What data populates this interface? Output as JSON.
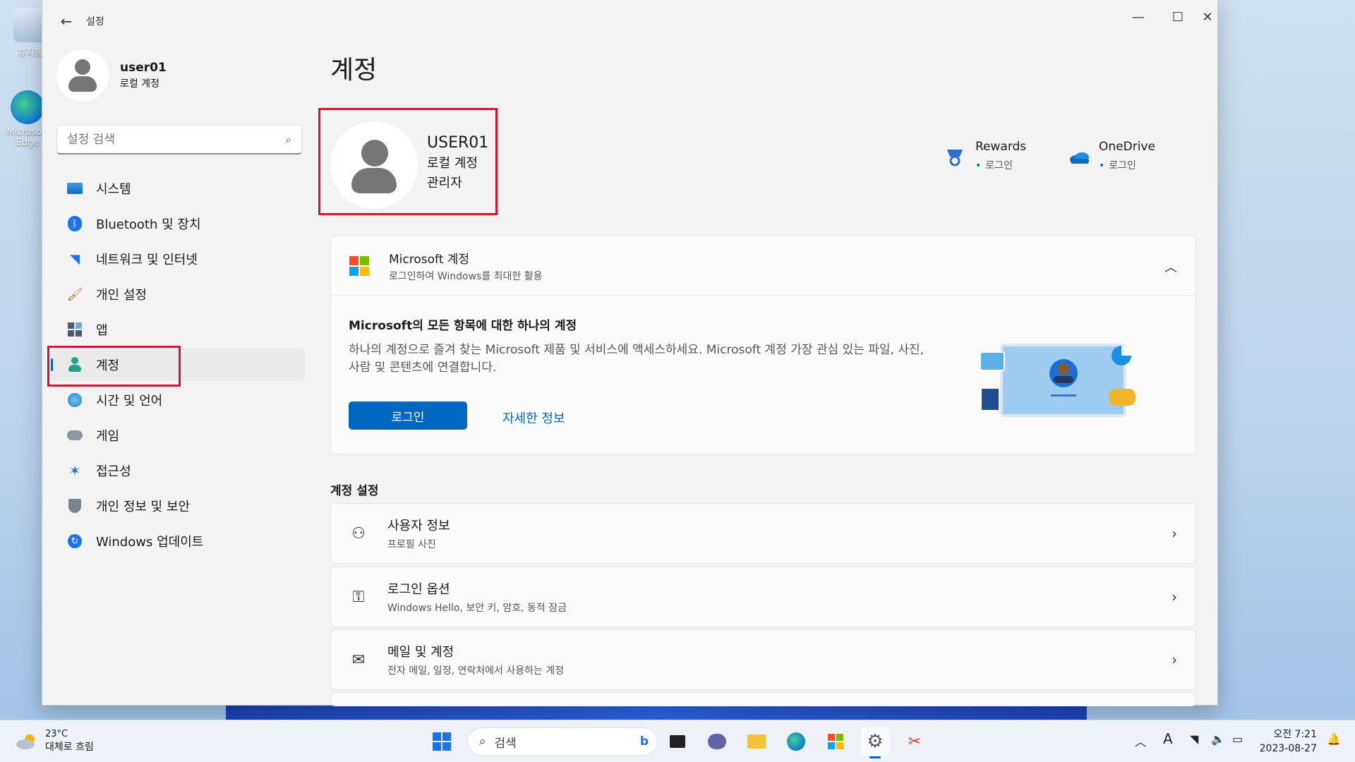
{
  "desktop": {
    "icons": [
      {
        "label": "휴지통"
      },
      {
        "label": "Microsoft Edge"
      }
    ]
  },
  "window": {
    "title": "설정",
    "controls": {
      "minimize": "—",
      "maximize": "☐",
      "close": "✕"
    }
  },
  "sidebar": {
    "profile": {
      "name": "user01",
      "account_type": "로컬 계정"
    },
    "search": {
      "placeholder": "설정 검색"
    },
    "items": [
      {
        "label": "시스템",
        "icon": "system-icon"
      },
      {
        "label": "Bluetooth 및 장치",
        "icon": "bluetooth-icon"
      },
      {
        "label": "네트워크 및 인터넷",
        "icon": "wifi-icon"
      },
      {
        "label": "개인 설정",
        "icon": "brush-icon"
      },
      {
        "label": "앱",
        "icon": "apps-icon"
      },
      {
        "label": "계정",
        "icon": "account-icon",
        "active": true
      },
      {
        "label": "시간 및 언어",
        "icon": "globe-clock-icon"
      },
      {
        "label": "게임",
        "icon": "gamepad-icon"
      },
      {
        "label": "접근성",
        "icon": "accessibility-icon"
      },
      {
        "label": "개인 정보 및 보안",
        "icon": "shield-icon"
      },
      {
        "label": "Windows 업데이트",
        "icon": "update-icon"
      }
    ]
  },
  "main": {
    "page_title": "계정",
    "account": {
      "name": "USER01",
      "type": "로컬 계정",
      "role": "관리자"
    },
    "services": [
      {
        "name": "Rewards",
        "status": "로그인"
      },
      {
        "name": "OneDrive",
        "status": "로그인"
      }
    ],
    "microsoft_card": {
      "title": "Microsoft 계정",
      "subtitle": "로그인하여 Windows를 최대한 활용",
      "heading": "Microsoft의 모든 항목에 대한 하나의 계정",
      "description": "하나의 계정으로 즐겨 찾는 Microsoft 제품 및 서비스에 액세스하세요. Microsoft 계정 가장 관심 있는 파일, 사진, 사람 및 콘텐츠에 연결합니다.",
      "signin_label": "로그인",
      "more_info_label": "자세한 정보"
    },
    "settings_section_title": "계정 설정",
    "settings_rows": [
      {
        "title": "사용자 정보",
        "subtitle": "프로필 사진",
        "icon": "user-info-icon"
      },
      {
        "title": "로그인 옵션",
        "subtitle": "Windows Hello, 보안 키, 암호, 동적 잠금",
        "icon": "key-icon"
      },
      {
        "title": "메일 및 계정",
        "subtitle": "전자 메일, 일정, 연락처에서 사용하는 계정",
        "icon": "mail-icon"
      }
    ]
  },
  "taskbar": {
    "weather": {
      "temp": "23°C",
      "condition": "대체로 흐림"
    },
    "search_placeholder": "검색",
    "apps": [
      "start-icon",
      "file-explorer-task-view-icon",
      "teams-icon",
      "folder-icon",
      "edge-icon",
      "store-icon",
      "settings-icon",
      "snipping-tool-icon"
    ],
    "tray": {
      "ime": "A"
    },
    "clock": {
      "time": "오전 7:21",
      "date": "2023-08-27"
    }
  },
  "colors": {
    "accent": "#0067c0",
    "highlight_red": "#e0102a",
    "highlight_purple": "#9b3aa6"
  }
}
